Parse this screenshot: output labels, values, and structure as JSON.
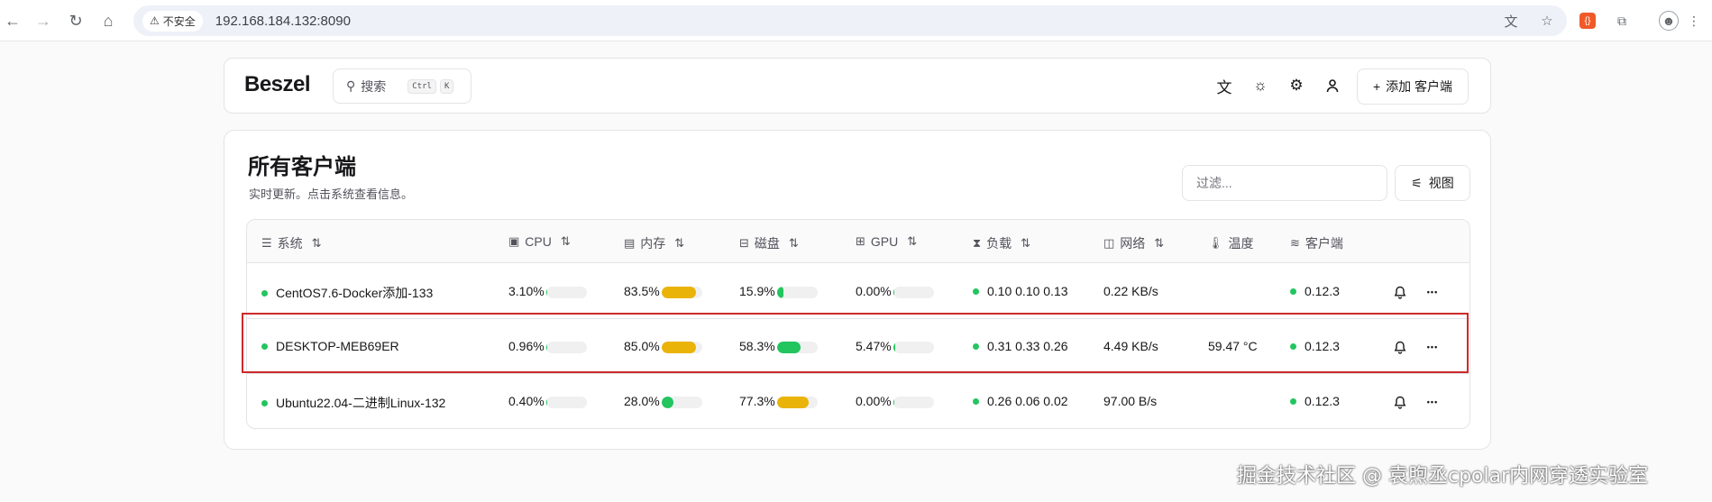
{
  "browser": {
    "insecure_label": "不安全",
    "url": "192.168.184.132:8090"
  },
  "header": {
    "logo": "Beszel",
    "search_label": "搜索",
    "search_kbd_ctrl": "Ctrl",
    "search_kbd_k": "K",
    "add_client_label": "添加 客户端"
  },
  "main": {
    "title": "所有客户端",
    "subtitle": "实时更新。点击系统查看信息。",
    "filter_placeholder": "过滤...",
    "view_label": "视图"
  },
  "table": {
    "columns": {
      "system": "系统",
      "cpu": "CPU",
      "memory": "内存",
      "disk": "磁盘",
      "gpu": "GPU",
      "load": "负载",
      "network": "网络",
      "temperature": "温度",
      "client": "客户端"
    },
    "rows": [
      {
        "name": "CentOS7.6-Docker添加-133",
        "cpu": "3.10%",
        "cpu_pct": 3.1,
        "mem": "83.5%",
        "mem_pct": 83.5,
        "disk": "15.9%",
        "disk_pct": 15.9,
        "gpu": "0.00%",
        "gpu_pct": 0,
        "load": "0.10 0.10 0.13",
        "net": "0.22 KB/s",
        "temp": "",
        "version": "0.12.3"
      },
      {
        "name": "DESKTOP-MEB69ER",
        "cpu": "0.96%",
        "cpu_pct": 0.96,
        "mem": "85.0%",
        "mem_pct": 85.0,
        "disk": "58.3%",
        "disk_pct": 58.3,
        "gpu": "5.47%",
        "gpu_pct": 5.47,
        "load": "0.31 0.33 0.26",
        "net": "4.49 KB/s",
        "temp": "59.47 °C",
        "version": "0.12.3"
      },
      {
        "name": "Ubuntu22.04-二进制Linux-132",
        "cpu": "0.40%",
        "cpu_pct": 0.4,
        "mem": "28.0%",
        "mem_pct": 28.0,
        "disk": "77.3%",
        "disk_pct": 77.3,
        "gpu": "0.00%",
        "gpu_pct": 0,
        "load": "0.26 0.06 0.02",
        "net": "97.00 B/s",
        "temp": "",
        "version": "0.12.3"
      }
    ]
  },
  "colors": {
    "green": "#22c55e",
    "yellow": "#eab308",
    "highlight": "#cc2a2a"
  },
  "watermark": "掘金技术社区 @ 袁煦丞cpolar内网穿透实验室"
}
